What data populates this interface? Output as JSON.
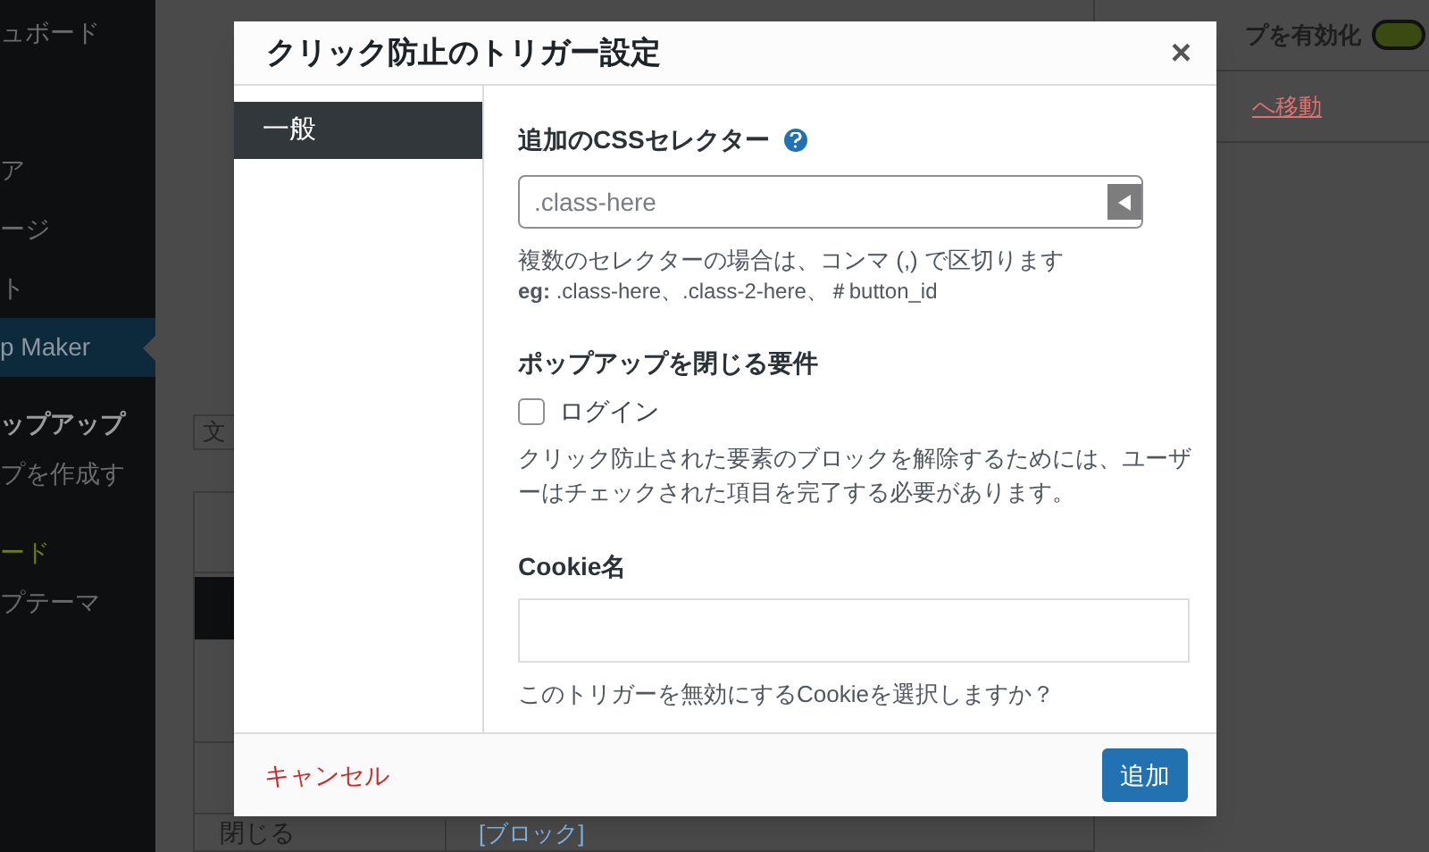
{
  "admin_menu": {
    "sections": [
      {
        "items": [
          {
            "label": "ュボード",
            "kind": "item",
            "selected": false
          }
        ]
      },
      {
        "items": [
          {
            "label": "ア",
            "kind": "item",
            "selected": false
          },
          {
            "label": "ージ",
            "kind": "item",
            "selected": false
          },
          {
            "label": "ト",
            "kind": "item",
            "selected": false
          },
          {
            "label": "p Maker",
            "kind": "current",
            "selected": true
          }
        ]
      },
      {
        "items": [
          {
            "label": "ップアップ",
            "kind": "submenu-current",
            "selected": false
          },
          {
            "label": "プを作成す",
            "kind": "item",
            "selected": false
          }
        ]
      },
      {
        "items": [
          {
            "label": "ード",
            "kind": "highlight",
            "selected": false
          },
          {
            "label": "プテーマ",
            "kind": "item",
            "selected": false
          }
        ]
      }
    ]
  },
  "background": {
    "text_button": "文",
    "table": {
      "rows": [
        {
          "cell_1": "閉じる",
          "cell_2": "[ブロック]"
        }
      ]
    },
    "side_panel": {
      "toggle_label": "プを有効化",
      "toggle_on": true,
      "link": "へ移動"
    }
  },
  "dialog": {
    "title": "クリック防止のトリガー設定",
    "close": "×",
    "tabs": [
      {
        "label": "一般",
        "selected": true
      }
    ],
    "fields": [
      {
        "kind": "text",
        "label": "追加のCSSセレクター",
        "help": true,
        "placeholder": ".class-here",
        "hint": "複数のセレクターの場合は、コンマ (,) で区切ります",
        "example": "**eg:** .class-here、.class-2-here、＃button_id"
      },
      {
        "kind": "checks",
        "label": "ポップアップを閉じる要件",
        "options": [
          {
            "label": "ログイン",
            "checked": false
          }
        ],
        "hint": "クリック防止された要素のブロックを解除するためには、ユーザーはチェックされた項目を完了する必要があります。"
      },
      {
        "kind": "plain",
        "label": "Cookie名",
        "hint": "このトリガーを無効にするCookieを選択しますか？"
      }
    ],
    "cancel": "キャンセル",
    "submit": "追加"
  }
}
